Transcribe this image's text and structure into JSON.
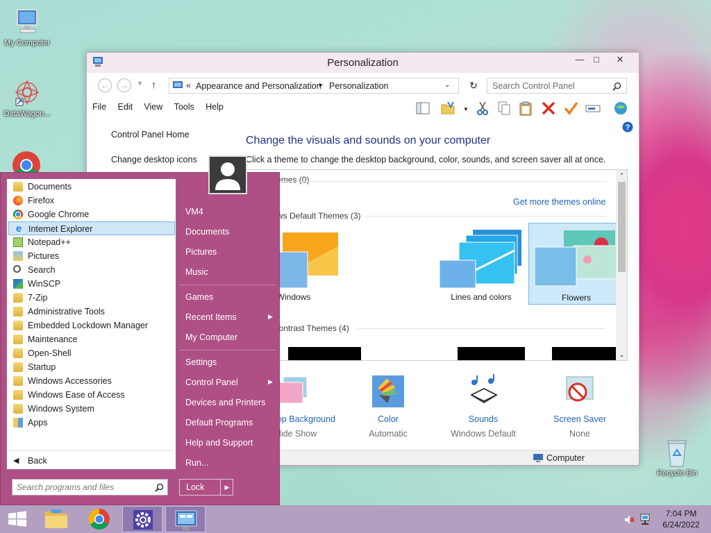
{
  "desktop": {
    "icons": [
      {
        "label": "My Computer",
        "icon": "computer-icon"
      },
      {
        "label": "DataWagon...",
        "icon": "app-icon"
      },
      {
        "label": "Recycle Bin",
        "icon": "recycle-bin-icon"
      }
    ]
  },
  "window": {
    "title": "Personalization",
    "breadcrumb": {
      "root": "«",
      "parent": "Appearance and Personalization",
      "current": "Personalization"
    },
    "search_placeholder": "Search Control Panel",
    "menu": [
      "File",
      "Edit",
      "View",
      "Tools",
      "Help"
    ],
    "left_nav": [
      "Control Panel Home",
      "Change desktop icons"
    ],
    "heading": "Change the visuals and sounds on your computer",
    "subheading": "Click a theme to change the desktop background, color, sounds, and screen saver all at once.",
    "groups": {
      "my_themes": "My Themes (0)",
      "get_more": "Get more themes online",
      "default_themes": "Windows Default Themes (3)",
      "high_contrast": "High Contrast Themes (4)"
    },
    "themes": [
      {
        "label": "Windows",
        "selected": false
      },
      {
        "label": "Lines and colors",
        "selected": false
      },
      {
        "label": "Flowers",
        "selected": true
      }
    ],
    "bottom": [
      {
        "title": "Desktop Background",
        "value": "Slide Show",
        "icon": "desktop-background-icon"
      },
      {
        "title": "Color",
        "value": "Automatic",
        "icon": "color-icon"
      },
      {
        "title": "Sounds",
        "value": "Windows Default",
        "icon": "sounds-icon"
      },
      {
        "title": "Screen Saver",
        "value": "None",
        "icon": "screen-saver-icon"
      }
    ],
    "status": "Computer"
  },
  "start_menu": {
    "programs": [
      {
        "label": "Documents",
        "icon": "folder-icon"
      },
      {
        "label": "Firefox",
        "icon": "firefox-icon"
      },
      {
        "label": "Google Chrome",
        "icon": "chrome-icon"
      },
      {
        "label": "Internet Explorer",
        "icon": "ie-icon",
        "selected": true
      },
      {
        "label": "Notepad++",
        "icon": "notepad-icon"
      },
      {
        "label": "Pictures",
        "icon": "pictures-icon"
      },
      {
        "label": "Search",
        "icon": "search-icon"
      },
      {
        "label": "WinSCP",
        "icon": "winscp-icon"
      },
      {
        "label": "7-Zip",
        "icon": "folder-icon"
      },
      {
        "label": "Administrative Tools",
        "icon": "folder-icon"
      },
      {
        "label": "Embedded Lockdown Manager",
        "icon": "folder-icon"
      },
      {
        "label": "Maintenance",
        "icon": "folder-icon"
      },
      {
        "label": "Open-Shell",
        "icon": "folder-icon"
      },
      {
        "label": "Startup",
        "icon": "folder-icon"
      },
      {
        "label": "Windows Accessories",
        "icon": "folder-icon"
      },
      {
        "label": "Windows Ease of Access",
        "icon": "folder-icon"
      },
      {
        "label": "Windows System",
        "icon": "folder-icon"
      },
      {
        "label": "Apps",
        "icon": "apps-icon"
      }
    ],
    "back": "Back",
    "search_placeholder": "Search programs and files",
    "right": [
      {
        "label": "VM4"
      },
      {
        "label": "Documents"
      },
      {
        "label": "Pictures"
      },
      {
        "label": "Music"
      },
      {
        "label": "Games"
      },
      {
        "label": "Recent Items",
        "arrow": true
      },
      {
        "label": "My Computer"
      },
      {
        "label": "Settings"
      },
      {
        "label": "Control Panel",
        "arrow": true
      },
      {
        "label": "Devices and Printers"
      },
      {
        "label": "Default Programs"
      },
      {
        "label": "Help and Support"
      },
      {
        "label": "Run..."
      }
    ],
    "lock": "Lock"
  },
  "taskbar": {
    "time": "7:04 PM",
    "date": "6/24/2022"
  },
  "colors": {
    "start_menu": "#ae4f86",
    "taskbar": "#b3a0c1",
    "link": "#1e64b4",
    "heading": "#1e3287"
  }
}
